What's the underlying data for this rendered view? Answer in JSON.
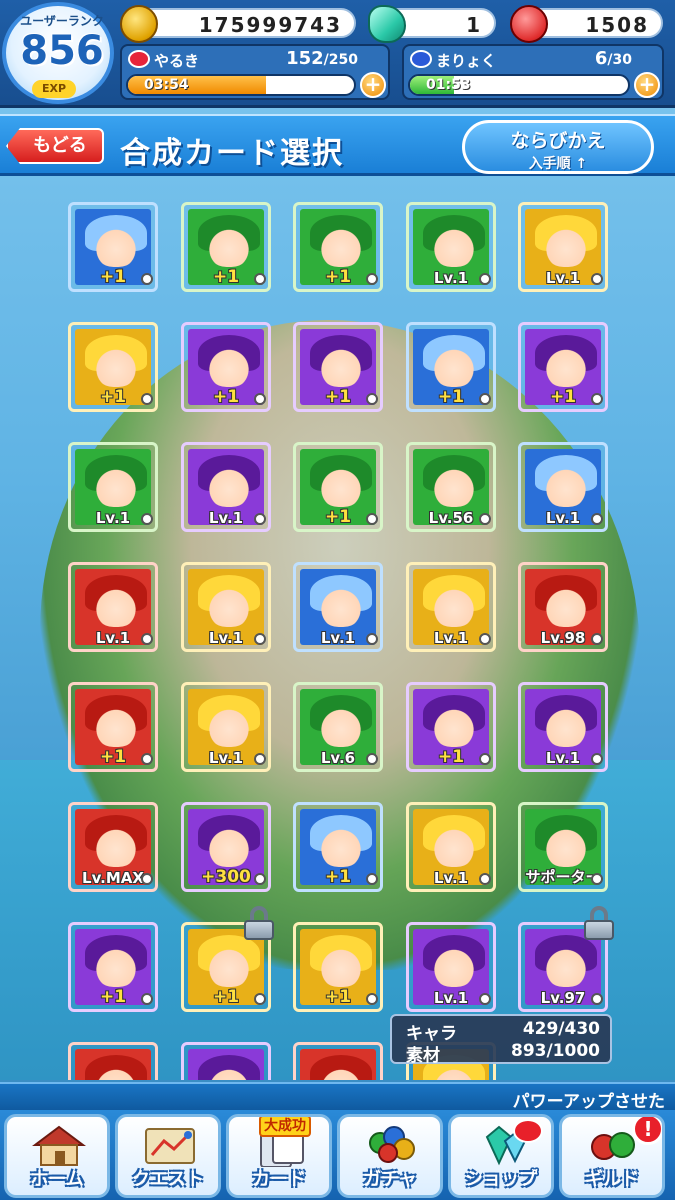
{
  "status": {
    "rank_label": "ユーザーランク",
    "rank": "856",
    "exp_label": "EXP",
    "coins": "175999743",
    "gems": "1",
    "tickets": "1508",
    "yaruki_label": "やるき",
    "yaruki_value": "152",
    "yaruki_max": "/250",
    "yaruki_timer": "03:54",
    "yaruki_fill": 0.61,
    "mana_label": "まりょく",
    "mana_value": "6",
    "mana_max": "/30",
    "mana_timer": "01:53",
    "mana_fill": 0.2,
    "plus": "+"
  },
  "header": {
    "back": "もどる",
    "title": "合成カード選択",
    "sort_label": "ならびかえ",
    "sort_order": "入手順 ↑"
  },
  "cards": [
    {
      "color": "water",
      "label": "+1"
    },
    {
      "color": "wood",
      "label": "+1"
    },
    {
      "color": "wood",
      "label": "+1"
    },
    {
      "color": "wood",
      "label": "Lv.1"
    },
    {
      "color": "light",
      "label": "Lv.1"
    },
    {
      "color": "light",
      "label": "+1"
    },
    {
      "color": "dark",
      "label": "+1"
    },
    {
      "color": "dark",
      "label": "+1"
    },
    {
      "color": "water",
      "label": "+1"
    },
    {
      "color": "dark",
      "label": "+1"
    },
    {
      "color": "wood",
      "label": "Lv.1"
    },
    {
      "color": "dark",
      "label": "Lv.1"
    },
    {
      "color": "wood",
      "label": "+1"
    },
    {
      "color": "wood",
      "label": "Lv.56"
    },
    {
      "color": "water",
      "label": "Lv.1"
    },
    {
      "color": "fire",
      "label": "Lv.1"
    },
    {
      "color": "light",
      "label": "Lv.1"
    },
    {
      "color": "water",
      "label": "Lv.1"
    },
    {
      "color": "light",
      "label": "Lv.1"
    },
    {
      "color": "fire",
      "label": "Lv.98"
    },
    {
      "color": "fire",
      "label": "+1"
    },
    {
      "color": "light",
      "label": "Lv.1"
    },
    {
      "color": "wood",
      "label": "Lv.6"
    },
    {
      "color": "dark",
      "label": "+1"
    },
    {
      "color": "dark",
      "label": "Lv.1"
    },
    {
      "color": "fire",
      "label": "Lv.MAX"
    },
    {
      "color": "dark",
      "label": "+300"
    },
    {
      "color": "water",
      "label": "+1"
    },
    {
      "color": "light",
      "label": "Lv.1"
    },
    {
      "color": "wood",
      "label": "サポーター"
    },
    {
      "color": "dark",
      "label": "+1"
    },
    {
      "color": "light",
      "label": "+1"
    },
    {
      "color": "light",
      "label": "+1"
    },
    {
      "color": "dark",
      "label": "Lv.1"
    },
    {
      "color": "dark",
      "label": "Lv.97"
    },
    {
      "color": "fire",
      "label": ""
    },
    {
      "color": "dark",
      "label": ""
    },
    {
      "color": "fire",
      "label": ""
    },
    {
      "color": "light",
      "label": ""
    }
  ],
  "counts": {
    "chara_label": "キャラ",
    "chara_value": "429/430",
    "material_label": "素材",
    "material_value": "893/1000"
  },
  "hint": "パワーアップさせた",
  "nav": [
    {
      "label": "ホーム",
      "icon": "house-icon"
    },
    {
      "label": "クエスト",
      "icon": "map-icon"
    },
    {
      "label": "カード",
      "icon": "card-icon",
      "badge": "大成功"
    },
    {
      "label": "ガチャ",
      "icon": "gacha-icon"
    },
    {
      "label": "ショップ",
      "icon": "gem-icon"
    },
    {
      "label": "ギルド",
      "icon": "guild-icon",
      "alert": "!"
    }
  ],
  "colors": {
    "water": "#2a6fd8",
    "wood": "#2fae3a",
    "fire": "#d8342a",
    "light": "#e8b018",
    "dark": "#8a3ad8"
  }
}
